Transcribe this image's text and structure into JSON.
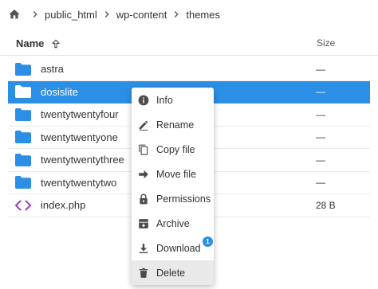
{
  "breadcrumb": {
    "segments": [
      "public_html",
      "wp-content",
      "themes"
    ]
  },
  "header": {
    "name_label": "Name",
    "size_label": "Size"
  },
  "files": [
    {
      "name": "astra",
      "size": "—",
      "type": "folder",
      "selected": false
    },
    {
      "name": "dosislite",
      "size": "—",
      "type": "folder",
      "selected": true
    },
    {
      "name": "twentytwentyfour",
      "size": "—",
      "type": "folder",
      "selected": false
    },
    {
      "name": "twentytwentyone",
      "size": "—",
      "type": "folder",
      "selected": false
    },
    {
      "name": "twentytwentythree",
      "size": "—",
      "type": "folder",
      "selected": false
    },
    {
      "name": "twentytwentytwo",
      "size": "—",
      "type": "folder",
      "selected": false
    },
    {
      "name": "index.php",
      "size": "28 B",
      "type": "code",
      "selected": false
    }
  ],
  "context_menu": {
    "items": [
      {
        "label": "Info",
        "icon": "info-icon"
      },
      {
        "label": "Rename",
        "icon": "pencil-icon"
      },
      {
        "label": "Copy file",
        "icon": "copy-icon"
      },
      {
        "label": "Move file",
        "icon": "arrow-right-icon"
      },
      {
        "label": "Permissions",
        "icon": "lock-icon"
      },
      {
        "label": "Archive",
        "icon": "archive-icon"
      },
      {
        "label": "Download",
        "icon": "download-icon",
        "badge": "1"
      },
      {
        "label": "Delete",
        "icon": "trash-icon",
        "hovered": true
      }
    ]
  },
  "colors": {
    "accent": "#2c8fe6",
    "folder": "#2c8fe6",
    "code_icon": "#9b3fc2",
    "menu_icon": "#4b4b4b"
  }
}
